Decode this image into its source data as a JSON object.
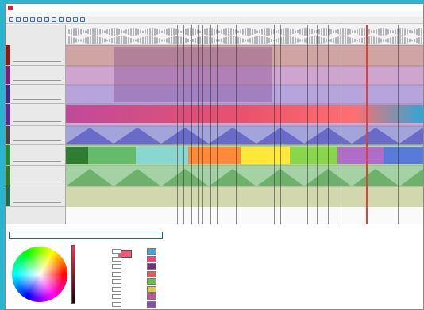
{
  "window": {
    "title": ""
  },
  "menu": [],
  "ruler": {
    "top_label": ""
  },
  "tracks": [
    {
      "label": "",
      "swatch": "#8a1b1b"
    },
    {
      "label": "",
      "swatch": "#7a1f7a"
    },
    {
      "label": "",
      "swatch": "#3e2a8a"
    },
    {
      "label": "",
      "swatch": "#5a2a9a"
    },
    {
      "label": "",
      "swatch": "#444444"
    },
    {
      "label": "",
      "swatch": "#1d8a3a"
    },
    {
      "label": "",
      "swatch": "#2a7a2a"
    },
    {
      "label": "",
      "swatch": "#1e6a4a"
    }
  ],
  "editor": {
    "scale_hint": ""
  },
  "lower": {
    "name_field": "",
    "params": [
      {
        "label": "",
        "value": ""
      },
      {
        "label": "",
        "value": ""
      },
      {
        "label": "",
        "value": ""
      },
      {
        "label": "",
        "value": ""
      },
      {
        "label": "",
        "value": ""
      },
      {
        "label": "",
        "value": ""
      },
      {
        "label": "",
        "value": ""
      },
      {
        "label": "",
        "value": ""
      }
    ],
    "palette": [
      "#4aa3df",
      "#e04b7a",
      "#7a2c8c",
      "#e05a5a",
      "#6bbf4e",
      "#e0c94a",
      "#c8509a",
      "#8a4ab8"
    ]
  },
  "colors": {
    "accent": "#29b5cf",
    "playhead": "#e8402d"
  }
}
